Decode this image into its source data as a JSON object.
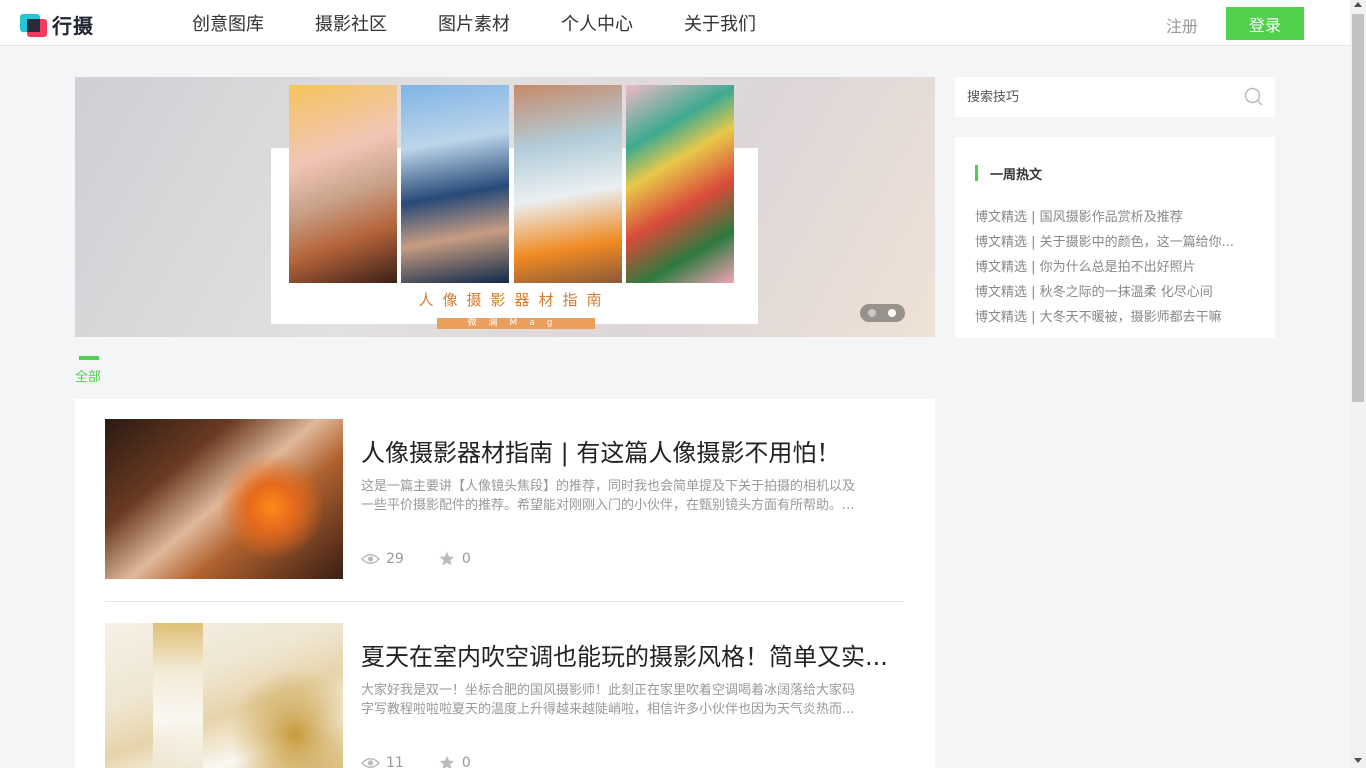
{
  "brand": {
    "name": "行摄"
  },
  "nav": {
    "items": [
      "创意图库",
      "摄影社区",
      "图片素材",
      "个人中心",
      "关于我们"
    ],
    "register": "注册",
    "login": "登录"
  },
  "banner": {
    "title": "人像摄影器材指南",
    "tag": "微澜Mag"
  },
  "tabs": {
    "active": "全部"
  },
  "articles": [
    {
      "title": "人像摄影器材指南 | 有这篇人像摄影不用怕！",
      "desc_line1": "这是一篇主要讲【人像镜头焦段】的推荐，同时我也会简单提及下关于拍摄的相机以及",
      "desc_line2": "一些平价摄影配件的推荐。希望能对刚刚入门的小伙伴，在甄别镜头方面有所帮助。...",
      "views": "29",
      "stars": "0"
    },
    {
      "title": "夏天在室内吹空调也能玩的摄影风格！简单又实...",
      "desc_line1": "大家好我是双一！坐标合肥的国风摄影师！此刻正在家里吹着空调喝着冰阔落给大家码",
      "desc_line2": "字写教程啦啦啦夏天的温度上升得越来越陡峭啦，相信许多小伙伴也因为天气炎热而...",
      "views": "11",
      "stars": "0"
    }
  ],
  "search": {
    "placeholder": "搜索技巧"
  },
  "hot": {
    "title": "一周热文",
    "items": [
      "博文精选 | 国风摄影作品赏析及推荐",
      "博文精选 | 关于摄影中的颜色，这一篇给你...",
      "博文精选 | 你为什么总是拍不出好照片",
      "博文精选 | 秋冬之际的一抹温柔 化尽心间",
      "博文精选 | 大冬天不暖被，摄影师都去干嘛"
    ]
  },
  "colors": {
    "accent": "#4fd14b",
    "brand_cyan": "#22c7d6",
    "brand_red": "#f23a5e"
  }
}
